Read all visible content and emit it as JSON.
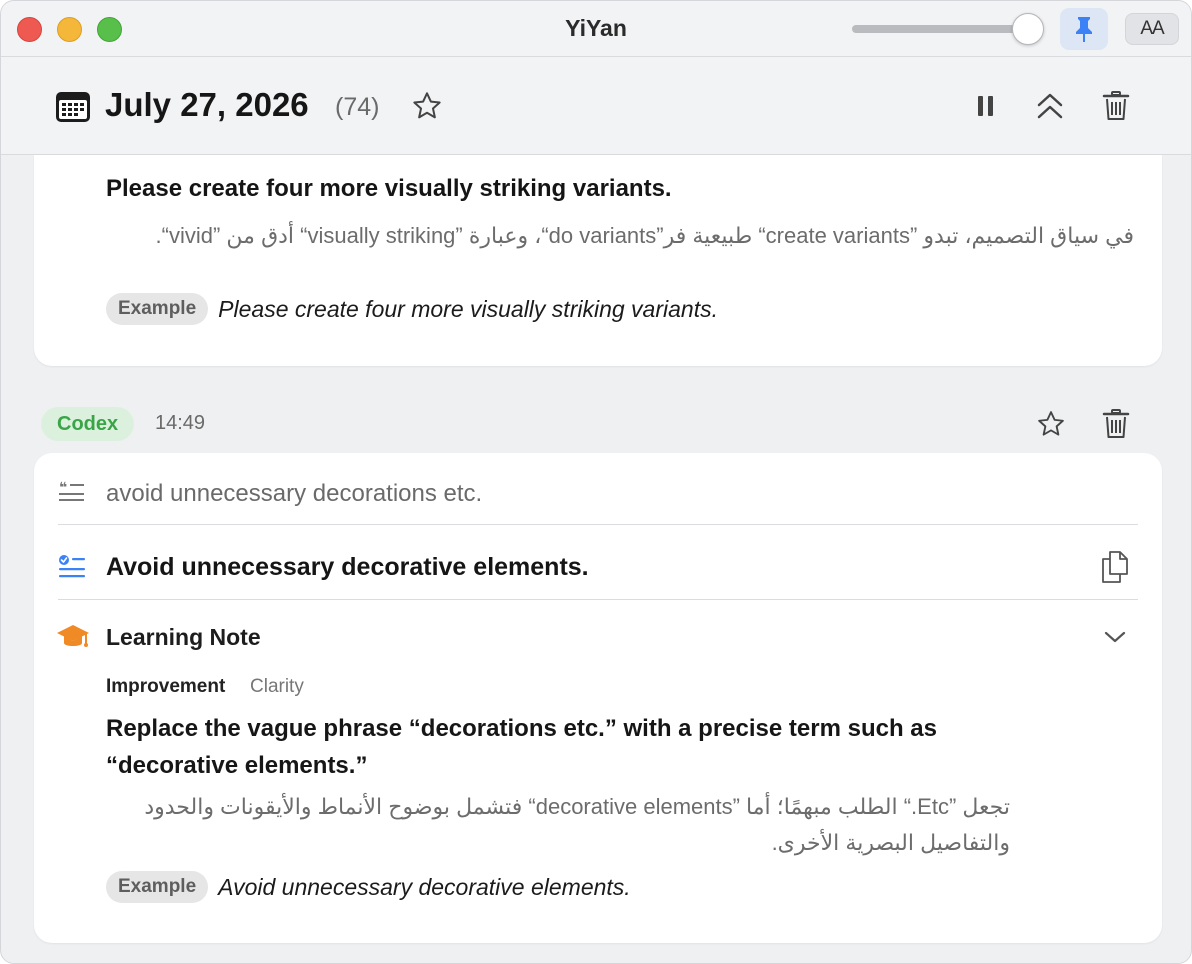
{
  "window": {
    "title": "YiYan",
    "font_size_button": "AA"
  },
  "header": {
    "date": "July 27, 2026",
    "count": "(74)"
  },
  "previous_entry": {
    "sentence": "Please create four more visually striking variants.",
    "note": "في سياق التصميم، تبدو ”create variants“ طبيعية فر”do variants“، وعبارة ”visually striking“ أدق من ”vivid“.",
    "example_label": "Example",
    "example": "Please create four more visually striking variants."
  },
  "entry": {
    "source": "Codex",
    "time": "14:49",
    "original": "avoid unnecessary decorations etc.",
    "corrected": "Avoid unnecessary decorative elements.",
    "learning_note": {
      "title": "Learning Note",
      "type": "Improvement",
      "tag": "Clarity",
      "suggestion": "Replace the vague phrase “decorations etc.” with a precise term such as “decorative elements.”",
      "explanation": "تجعل ”Etc.“ الطلب مبهمًا؛ أما ”decorative elements“ فتشمل بوضوح الأنماط والأيقونات والحدود والتفاصيل البصرية الأخرى.",
      "example_label": "Example",
      "example": "Avoid unnecessary decorative elements."
    }
  },
  "colors": {
    "accent_blue": "#3b82f6",
    "codex_green": "#3aa548",
    "cap_orange": "#f08a24"
  }
}
